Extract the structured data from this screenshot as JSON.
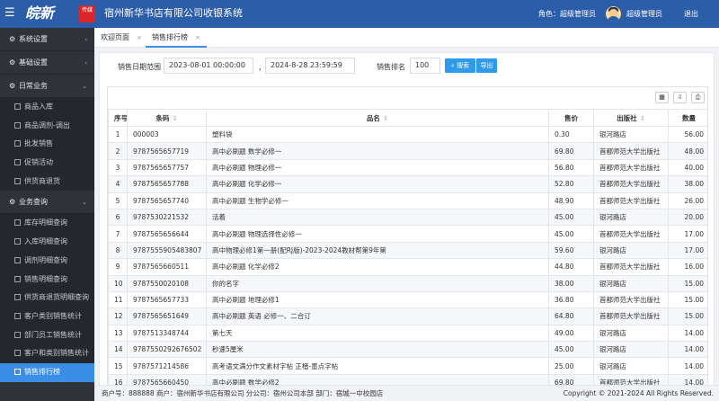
{
  "header": {
    "app_title": "宿州新华书店有限公司收银系统",
    "logo_text": "皖新",
    "logo_badge": "传媒",
    "role": "角色：超级管理员",
    "user_name": "超级管理员",
    "logout": "退出",
    "menu_icon": "hamburger-icon",
    "bar_color": "#2b5da8"
  },
  "sidebar": {
    "groups": [
      {
        "label": "系统设置",
        "icon": "gear-icon",
        "arrow": "‹"
      },
      {
        "label": "基础设置",
        "icon": "gear-icon",
        "arrow": "‹"
      },
      {
        "label": "日常业务",
        "icon": "gear-icon",
        "arrow": "⌄"
      },
      {
        "label": "业务查询",
        "icon": "gear-icon",
        "arrow": "⌄"
      }
    ],
    "daily_items": [
      "商品入库",
      "商品调剂-调出",
      "批发销售",
      "促销活动",
      "供货商退货"
    ],
    "query_items": [
      "库存明细查询",
      "入库明细查询",
      "调剂明细查询",
      "销售明细查询",
      "供货商退货明细查询",
      "客户类别销售统计",
      "部门员工销售统计",
      "客户和类别销售统计",
      "销售排行榜"
    ],
    "active_color": "#3a8ee6"
  },
  "tabs": [
    {
      "label": "欢迎页面",
      "close": "×"
    },
    {
      "label": "销售排行榜",
      "close": "×"
    }
  ],
  "filter": {
    "date_label": "销售日期范围",
    "start": "2023-08-01 00:00:00",
    "separator": "，",
    "end": "2024-8-28 23:59:59",
    "rank_label": "销售排名",
    "rank_value": "100",
    "search_button": "搜索",
    "export_button": "导出"
  },
  "table": {
    "columns": [
      "序号",
      "条码",
      "品名",
      "售价",
      "出版社",
      "数量"
    ],
    "rows": [
      [
        "1",
        "000003",
        "塑料袋",
        "0.30",
        "银河路店",
        "56.00"
      ],
      [
        "2",
        "9787565657719",
        "高中必刷题 数学必修一",
        "69.80",
        "首都师范大学出版社",
        "48.00"
      ],
      [
        "3",
        "9787565657757",
        "高中必刷题 物理必修一",
        "56.80",
        "首都师范大学出版社",
        "40.00"
      ],
      [
        "4",
        "9787565657788",
        "高中必刷题 化学必修一",
        "52.80",
        "首都师范大学出版社",
        "38.00"
      ],
      [
        "5",
        "9787565657740",
        "高中必刷题 生物学必修一",
        "48.90",
        "首都师范大学出版社",
        "26.00"
      ],
      [
        "6",
        "9787530221532",
        "活着",
        "45.00",
        "银河路店",
        "20.00"
      ],
      [
        "7",
        "9787565656644",
        "高中必刷题 物理选择性必修一",
        "45.00",
        "首都师范大学出版社",
        "17.00"
      ],
      [
        "8",
        "9787555905483807",
        "高中物理必修1第一册(配RJ版)-2023-2024教材帮第9年第",
        "59.60",
        "银河路店",
        "17.00"
      ],
      [
        "9",
        "9787565660511",
        "高中必刷题 化学必修2",
        "44.80",
        "首都师范大学出版社",
        "16.00"
      ],
      [
        "10",
        "9787550020108",
        "你的名字",
        "38.00",
        "银河路店",
        "15.00"
      ],
      [
        "11",
        "9787565657733",
        "高中必刷题 地理必修1",
        "36.80",
        "首都师范大学出版社",
        "15.00"
      ],
      [
        "12",
        "9787565651649",
        "高中必刷题 英语 必修一、二合订",
        "64.80",
        "首都师范大学出版社",
        "15.00"
      ],
      [
        "13",
        "9787513348744",
        "第七天",
        "49.00",
        "银河路店",
        "14.00"
      ],
      [
        "14",
        "9787550292676502",
        "秒速5厘米",
        "45.00",
        "银河路店",
        "14.00"
      ],
      [
        "15",
        "9787571214586",
        "高考语文满分作文素材字帖 正楷-墨点字帖",
        "25.00",
        "银河路店",
        "14.00"
      ],
      [
        "16",
        "9787565660450",
        "高中必刷题 数学必修2",
        "69.80",
        "首都师范大学出版社",
        "14.00"
      ]
    ]
  },
  "footer": {
    "info": "商户号：888888   商户：宿州新华书店有限公司   分公司：宿州公司本部   部门：宿城一中校园店",
    "copyright": "Copyright © 2021-2024 All Rights Reserved."
  }
}
